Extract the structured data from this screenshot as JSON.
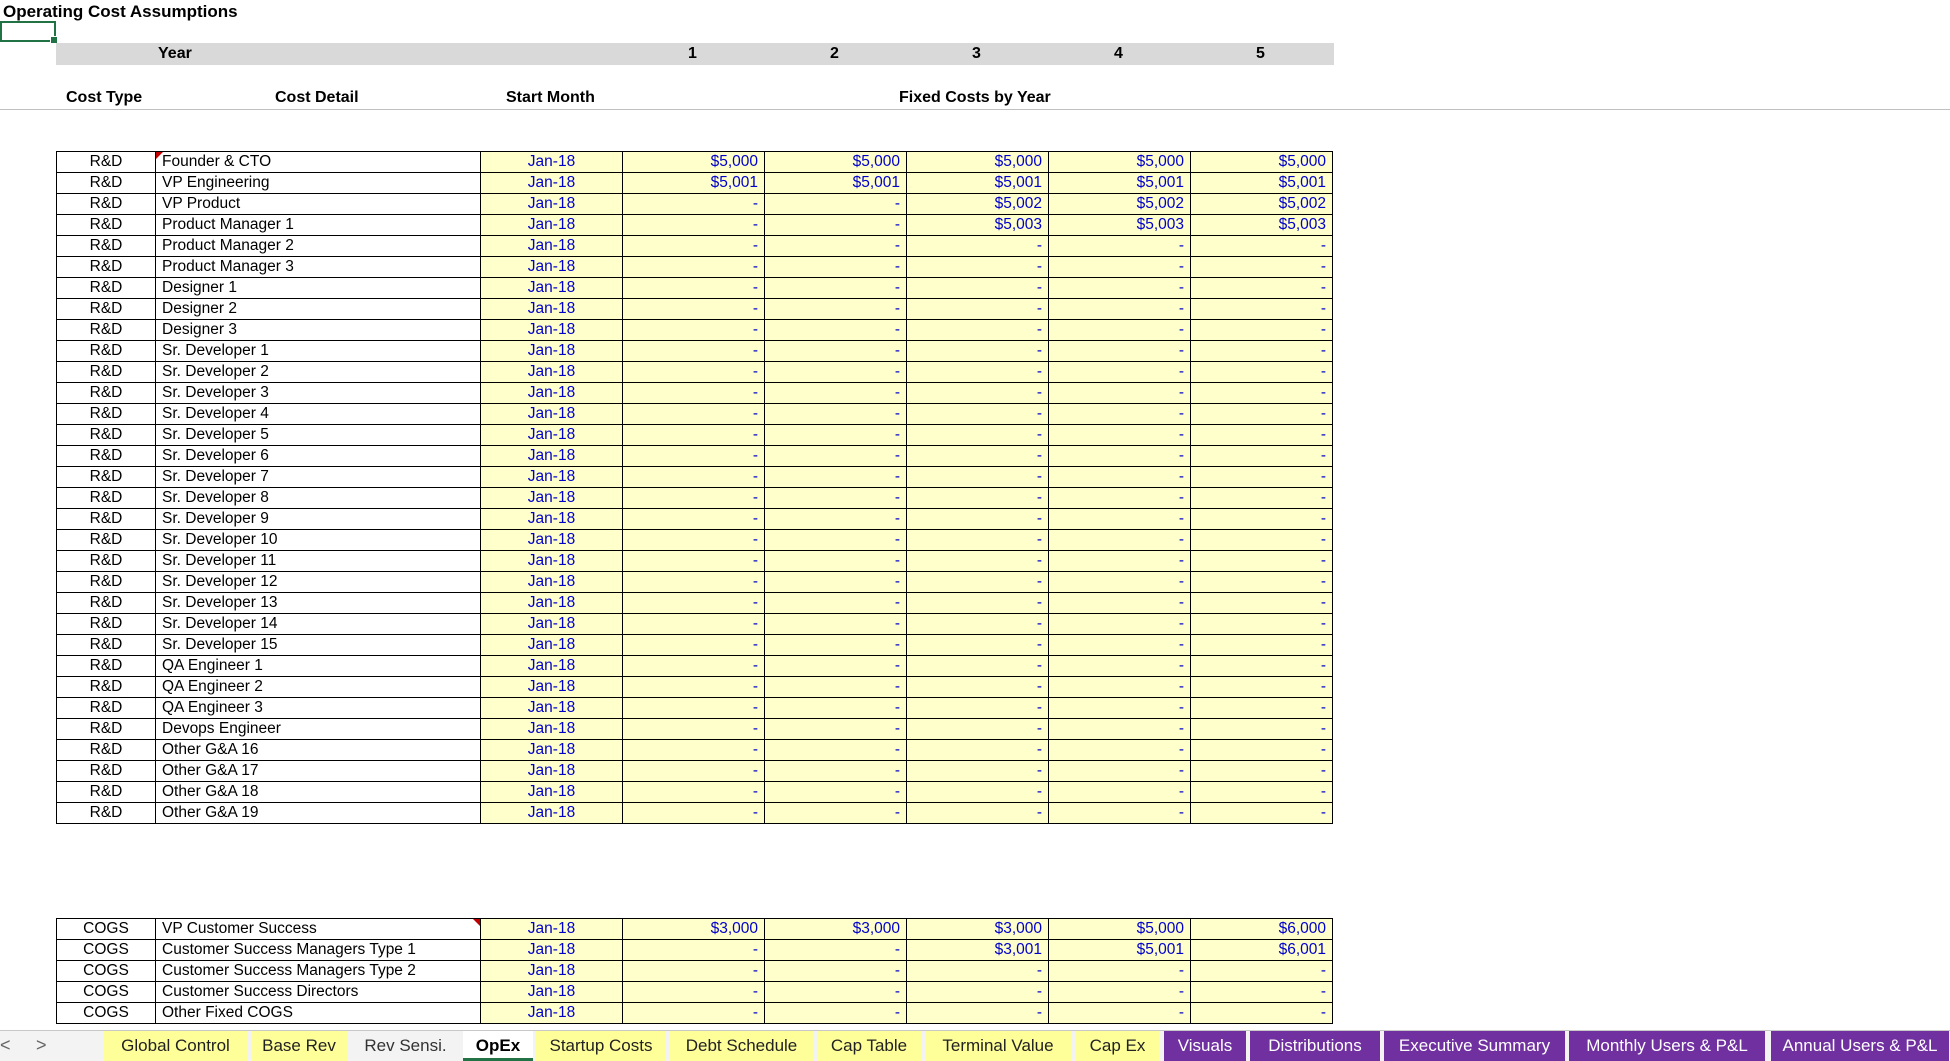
{
  "sheet": {
    "title": "Operating Cost Assumptions",
    "year_label": "Year",
    "years": [
      "1",
      "2",
      "3",
      "4",
      "5"
    ],
    "headers": {
      "cost_type": "Cost Type",
      "cost_detail": "Cost Detail",
      "start_month": "Start Month",
      "fixed_costs": "Fixed Costs by Year"
    },
    "rd_rows": [
      {
        "type": "R&D",
        "detail": "Founder & CTO",
        "start": "Jan-18",
        "values": [
          "$5,000",
          "$5,000",
          "$5,000",
          "$5,000",
          "$5,000"
        ]
      },
      {
        "type": "R&D",
        "detail": "VP Engineering",
        "start": "Jan-18",
        "values": [
          "$5,001",
          "$5,001",
          "$5,001",
          "$5,001",
          "$5,001"
        ]
      },
      {
        "type": "R&D",
        "detail": "VP Product",
        "start": "Jan-18",
        "values": [
          "-",
          "-",
          "$5,002",
          "$5,002",
          "$5,002"
        ]
      },
      {
        "type": "R&D",
        "detail": "Product Manager 1",
        "start": "Jan-18",
        "values": [
          "-",
          "-",
          "$5,003",
          "$5,003",
          "$5,003"
        ]
      },
      {
        "type": "R&D",
        "detail": "Product Manager 2",
        "start": "Jan-18",
        "values": [
          "-",
          "-",
          "-",
          "-",
          "-"
        ]
      },
      {
        "type": "R&D",
        "detail": "Product Manager 3",
        "start": "Jan-18",
        "values": [
          "-",
          "-",
          "-",
          "-",
          "-"
        ]
      },
      {
        "type": "R&D",
        "detail": "Designer 1",
        "start": "Jan-18",
        "values": [
          "-",
          "-",
          "-",
          "-",
          "-"
        ]
      },
      {
        "type": "R&D",
        "detail": "Designer 2",
        "start": "Jan-18",
        "values": [
          "-",
          "-",
          "-",
          "-",
          "-"
        ]
      },
      {
        "type": "R&D",
        "detail": "Designer 3",
        "start": "Jan-18",
        "values": [
          "-",
          "-",
          "-",
          "-",
          "-"
        ]
      },
      {
        "type": "R&D",
        "detail": "Sr. Developer 1",
        "start": "Jan-18",
        "values": [
          "-",
          "-",
          "-",
          "-",
          "-"
        ]
      },
      {
        "type": "R&D",
        "detail": "Sr. Developer 2",
        "start": "Jan-18",
        "values": [
          "-",
          "-",
          "-",
          "-",
          "-"
        ]
      },
      {
        "type": "R&D",
        "detail": "Sr. Developer 3",
        "start": "Jan-18",
        "values": [
          "-",
          "-",
          "-",
          "-",
          "-"
        ]
      },
      {
        "type": "R&D",
        "detail": "Sr. Developer 4",
        "start": "Jan-18",
        "values": [
          "-",
          "-",
          "-",
          "-",
          "-"
        ]
      },
      {
        "type": "R&D",
        "detail": "Sr. Developer 5",
        "start": "Jan-18",
        "values": [
          "-",
          "-",
          "-",
          "-",
          "-"
        ]
      },
      {
        "type": "R&D",
        "detail": "Sr. Developer 6",
        "start": "Jan-18",
        "values": [
          "-",
          "-",
          "-",
          "-",
          "-"
        ]
      },
      {
        "type": "R&D",
        "detail": "Sr. Developer 7",
        "start": "Jan-18",
        "values": [
          "-",
          "-",
          "-",
          "-",
          "-"
        ]
      },
      {
        "type": "R&D",
        "detail": "Sr. Developer 8",
        "start": "Jan-18",
        "values": [
          "-",
          "-",
          "-",
          "-",
          "-"
        ]
      },
      {
        "type": "R&D",
        "detail": "Sr. Developer 9",
        "start": "Jan-18",
        "values": [
          "-",
          "-",
          "-",
          "-",
          "-"
        ]
      },
      {
        "type": "R&D",
        "detail": "Sr. Developer 10",
        "start": "Jan-18",
        "values": [
          "-",
          "-",
          "-",
          "-",
          "-"
        ]
      },
      {
        "type": "R&D",
        "detail": "Sr. Developer 11",
        "start": "Jan-18",
        "values": [
          "-",
          "-",
          "-",
          "-",
          "-"
        ]
      },
      {
        "type": "R&D",
        "detail": "Sr. Developer 12",
        "start": "Jan-18",
        "values": [
          "-",
          "-",
          "-",
          "-",
          "-"
        ]
      },
      {
        "type": "R&D",
        "detail": "Sr. Developer 13",
        "start": "Jan-18",
        "values": [
          "-",
          "-",
          "-",
          "-",
          "-"
        ]
      },
      {
        "type": "R&D",
        "detail": "Sr. Developer 14",
        "start": "Jan-18",
        "values": [
          "-",
          "-",
          "-",
          "-",
          "-"
        ]
      },
      {
        "type": "R&D",
        "detail": "Sr. Developer 15",
        "start": "Jan-18",
        "values": [
          "-",
          "-",
          "-",
          "-",
          "-"
        ]
      },
      {
        "type": "R&D",
        "detail": "QA Engineer 1",
        "start": "Jan-18",
        "values": [
          "-",
          "-",
          "-",
          "-",
          "-"
        ]
      },
      {
        "type": "R&D",
        "detail": "QA Engineer 2",
        "start": "Jan-18",
        "values": [
          "-",
          "-",
          "-",
          "-",
          "-"
        ]
      },
      {
        "type": "R&D",
        "detail": "QA Engineer 3",
        "start": "Jan-18",
        "values": [
          "-",
          "-",
          "-",
          "-",
          "-"
        ]
      },
      {
        "type": "R&D",
        "detail": "Devops Engineer",
        "start": "Jan-18",
        "values": [
          "-",
          "-",
          "-",
          "-",
          "-"
        ]
      },
      {
        "type": "R&D",
        "detail": "Other G&A 16",
        "start": "Jan-18",
        "values": [
          "-",
          "-",
          "-",
          "-",
          "-"
        ]
      },
      {
        "type": "R&D",
        "detail": "Other G&A 17",
        "start": "Jan-18",
        "values": [
          "-",
          "-",
          "-",
          "-",
          "-"
        ]
      },
      {
        "type": "R&D",
        "detail": "Other G&A 18",
        "start": "Jan-18",
        "values": [
          "-",
          "-",
          "-",
          "-",
          "-"
        ]
      },
      {
        "type": "R&D",
        "detail": "Other G&A 19",
        "start": "Jan-18",
        "values": [
          "-",
          "-",
          "-",
          "-",
          "-"
        ]
      }
    ],
    "cogs_rows": [
      {
        "type": "COGS",
        "detail": "VP Customer Success",
        "start": "Jan-18",
        "values": [
          "$3,000",
          "$3,000",
          "$3,000",
          "$5,000",
          "$6,000"
        ]
      },
      {
        "type": "COGS",
        "detail": "Customer Success Managers Type 1",
        "start": "Jan-18",
        "values": [
          "-",
          "-",
          "$3,001",
          "$5,001",
          "$6,001"
        ]
      },
      {
        "type": "COGS",
        "detail": "Customer Success Managers Type 2",
        "start": "Jan-18",
        "values": [
          "-",
          "-",
          "-",
          "-",
          "-"
        ]
      },
      {
        "type": "COGS",
        "detail": "Customer Success Directors",
        "start": "Jan-18",
        "values": [
          "-",
          "-",
          "-",
          "-",
          "-"
        ]
      },
      {
        "type": "COGS",
        "detail": "Other Fixed COGS",
        "start": "Jan-18",
        "values": [
          "-",
          "-",
          "-",
          "-",
          "-"
        ]
      }
    ]
  },
  "tabs": {
    "nav_prev": "<",
    "nav_next": ">",
    "items": [
      {
        "label": "Global Control",
        "style": "yellow"
      },
      {
        "label": "Base Rev",
        "style": "yellow"
      },
      {
        "label": "Rev Sensi.",
        "style": "plain"
      },
      {
        "label": "OpEx",
        "style": "active"
      },
      {
        "label": "Startup Costs",
        "style": "yellow"
      },
      {
        "label": "Debt Schedule",
        "style": "yellow"
      },
      {
        "label": "Cap Table",
        "style": "yellow"
      },
      {
        "label": "Terminal Value",
        "style": "yellow"
      },
      {
        "label": "Cap Ex",
        "style": "yellow"
      },
      {
        "label": "Visuals",
        "style": "purple"
      },
      {
        "label": "Distributions",
        "style": "purple"
      },
      {
        "label": "Executive Summary",
        "style": "purple"
      },
      {
        "label": "Monthly Users & P&L",
        "style": "purple"
      },
      {
        "label": "Annual Users & P&L",
        "style": "purple"
      }
    ],
    "colors": {
      "yellow": "#ffff99",
      "purple": "#7030a0",
      "active_underline": "#217346"
    }
  }
}
